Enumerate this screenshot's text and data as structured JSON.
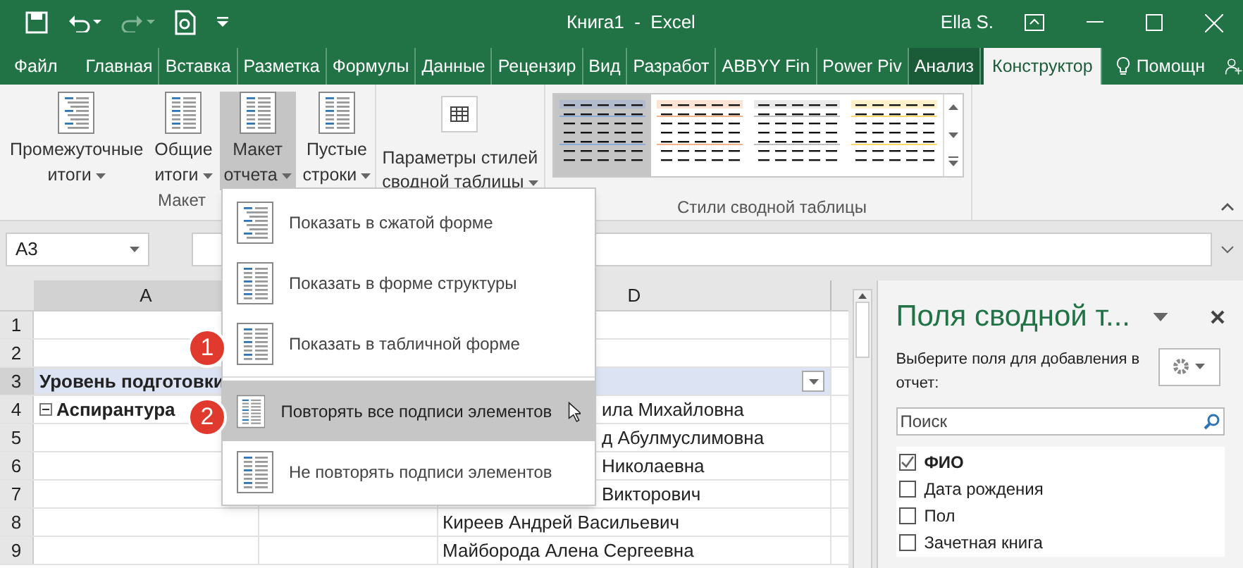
{
  "title_bar": {
    "title": "Книга1  -  Excel",
    "user": "Ella S."
  },
  "tabs": [
    {
      "label": "Файл",
      "selected": false,
      "contextual": false
    },
    {
      "label": "Главная",
      "selected": false,
      "contextual": false
    },
    {
      "label": "Вставка",
      "selected": false,
      "contextual": false
    },
    {
      "label": "Разметка",
      "selected": false,
      "contextual": false
    },
    {
      "label": "Формулы",
      "selected": false,
      "contextual": false
    },
    {
      "label": "Данные",
      "selected": false,
      "contextual": false
    },
    {
      "label": "Рецензир",
      "selected": false,
      "contextual": false
    },
    {
      "label": "Вид",
      "selected": false,
      "contextual": false
    },
    {
      "label": "Разработ",
      "selected": false,
      "contextual": false
    },
    {
      "label": "ABBYY Fin",
      "selected": false,
      "contextual": false
    },
    {
      "label": "Power Piv",
      "selected": false,
      "contextual": false
    },
    {
      "label": "Анализ",
      "selected": false,
      "contextual": true
    },
    {
      "label": "Конструктор",
      "selected": true,
      "contextual": true
    }
  ],
  "help": "Помощн",
  "ribbon": {
    "layout_group": {
      "label": "Макет",
      "buttons": [
        {
          "line1": "Промежуточные",
          "line2": "итоги",
          "pressed": false
        },
        {
          "line1": "Общие",
          "line2": "итоги",
          "pressed": false
        },
        {
          "line1": "Макет",
          "line2": "отчета",
          "pressed": true
        },
        {
          "line1": "Пустые",
          "line2": "строки",
          "pressed": false
        }
      ]
    },
    "options": {
      "line1": "Параметры стилей",
      "line2": "сводной таблицы"
    },
    "styles_group": {
      "label": "Стили сводной таблицы",
      "swatches": [
        {
          "color": "#8eaadb",
          "selected": true
        },
        {
          "color": "#f4b183",
          "selected": false
        },
        {
          "color": "#bfbfbf",
          "selected": false
        },
        {
          "color": "#ffd966",
          "selected": false
        }
      ]
    }
  },
  "name_box": "A3",
  "grid": {
    "columns": [
      {
        "label": "A"
      },
      {
        "label": "D"
      }
    ],
    "rows": [
      {
        "number": "1",
        "header": false
      },
      {
        "number": "2",
        "header": false
      },
      {
        "number": "3",
        "a": "Уровень подготовки",
        "header": true
      },
      {
        "number": "4",
        "a": "Аспирантура",
        "d": "ила Михайловна",
        "header": false,
        "behind_menu": true
      },
      {
        "number": "5",
        "d": "д Абулмуслимовна",
        "header": false,
        "behind_menu": true
      },
      {
        "number": "6",
        "d": "Николаевна",
        "header": false,
        "behind_menu": true
      },
      {
        "number": "7",
        "d": "Викторович",
        "header": false,
        "behind_menu": true
      },
      {
        "number": "8",
        "d": "Киреев Андрей Васильевич",
        "header": false,
        "behind_menu": false
      },
      {
        "number": "9",
        "d": "Майборода Алена Сергеевна",
        "header": false,
        "behind_menu": false
      }
    ]
  },
  "menu": {
    "items": [
      {
        "label": "Показать в сжатой форме",
        "selected": false
      },
      {
        "label": "Показать в форме структуры",
        "selected": false
      },
      {
        "label": "Показать в табличной форме",
        "selected": false,
        "badge": "1"
      },
      {
        "label": "Повторять все подписи элементов",
        "selected": true,
        "badge": "2"
      },
      {
        "label": "Не повторять подписи элементов",
        "selected": false
      }
    ]
  },
  "pane": {
    "title": "Поля сводной т...",
    "hint": "Выберите поля для добавления в отчет:",
    "search": {
      "placeholder": "Поиск"
    },
    "fields": [
      {
        "label": "ФИО",
        "checked": true
      },
      {
        "label": "Дата рождения",
        "checked": false
      },
      {
        "label": "Пол",
        "checked": false
      },
      {
        "label": "Зачетная книга",
        "checked": false
      }
    ]
  }
}
